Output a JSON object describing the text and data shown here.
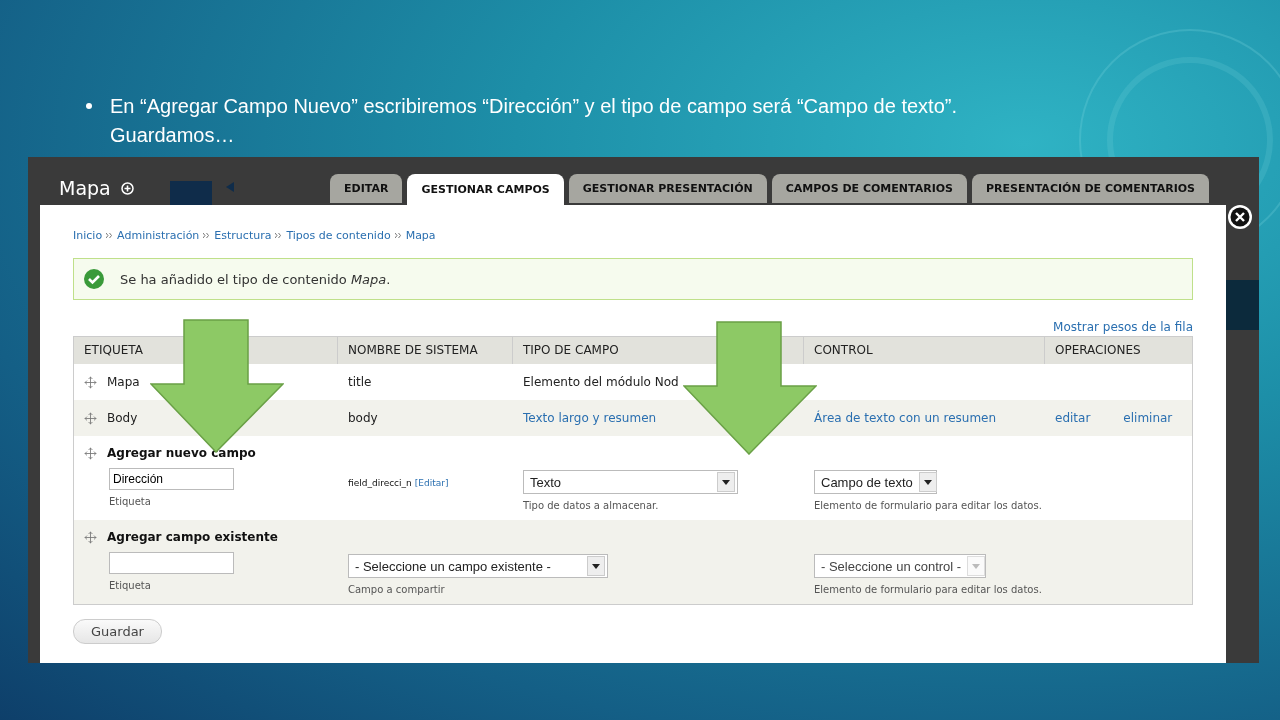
{
  "slide": {
    "bullet": "En “Agregar Campo Nuevo” escribiremos “Dirección” y el tipo de campo será “Campo de texto”. Guardamos…"
  },
  "screen": {
    "title": "Mapa",
    "tabs": [
      {
        "label": "EDITAR",
        "selected": false
      },
      {
        "label": "GESTIONAR CAMPOS",
        "selected": true
      },
      {
        "label": "GESTIONAR PRESENTACIÓN",
        "selected": false
      },
      {
        "label": "CAMPOS DE COMENTARIOS",
        "selected": false
      },
      {
        "label": "PRESENTACIÓN DE COMENTARIOS",
        "selected": false
      }
    ],
    "breadcrumb": [
      "Inicio",
      "Administración",
      "Estructura",
      "Tipos de contenido",
      "Mapa"
    ],
    "message": "Se ha añadido el tipo de contenido *Mapa*.",
    "show_weights": "Mostrar pesos de la fila",
    "table": {
      "columns": [
        "ETIQUETA",
        "NOMBRE DE SISTEMA",
        "TIPO DE CAMPO",
        "CONTROL",
        "OPERACIONES"
      ],
      "rows": [
        {
          "label": "Mapa",
          "machine_name": "title",
          "field_type": {
            "text": "Elemento del módulo Nod",
            "link": false
          }
        },
        {
          "label": "Body",
          "machine_name": "body",
          "field_type": {
            "text": "Texto largo y resumen",
            "link": true
          },
          "widget": "Área de texto con un resumen",
          "operations": [
            "editar",
            "eliminar"
          ]
        }
      ],
      "new_field": {
        "title": "Agregar nuevo campo",
        "label_value": "Dirección",
        "label_hint": "Etiqueta",
        "machine_name": "field_direcci_n",
        "machine_edit": "[Editar]",
        "type_select": "Texto",
        "type_hint": "Tipo de datos a almacenar.",
        "widget_select": "Campo de texto",
        "widget_hint": "Elemento de formulario para editar los datos."
      },
      "existing_field": {
        "title": "Agregar campo existente",
        "label_hint": "Etiqueta",
        "field_select": "- Seleccione un campo existente -",
        "field_hint": "Campo a compartir",
        "widget_select": "- Seleccione un control -",
        "widget_disabled": true,
        "widget_hint": "Elemento de formulario para editar los datos."
      }
    },
    "save_button": "Guardar"
  }
}
